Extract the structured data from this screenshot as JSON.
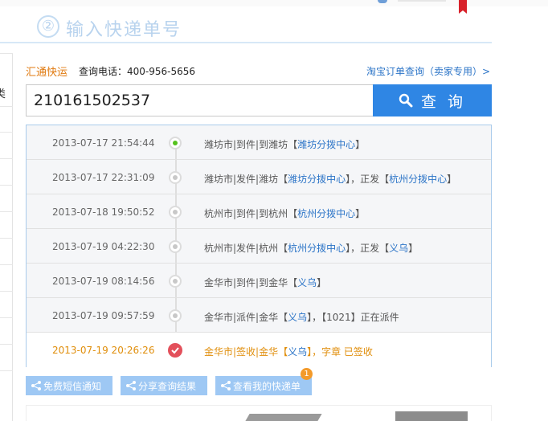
{
  "step": {
    "number": "②",
    "title": "输入快递单号"
  },
  "company": {
    "name": "汇通快运",
    "phone": "查询电话：400-956-5656"
  },
  "taobao_link": "淘宝订单查询（卖家专用）>",
  "search": {
    "value": "210161502537",
    "button_label": "查 询"
  },
  "left_rail": {
    "char": "类"
  },
  "timeline": [
    {
      "time": "2013-07-17 21:54:44",
      "text": "潍坊市|到件|到潍坊【",
      "link1": "潍坊分拨中心",
      "text2": "】",
      "link2": "",
      "text3": ""
    },
    {
      "time": "2013-07-17 22:31:09",
      "text": "潍坊市|发件|潍坊【",
      "link1": "潍坊分拨中心",
      "text2": "】，正发【",
      "link2": "杭州分拨中心",
      "text3": "】"
    },
    {
      "time": "2013-07-18 19:50:52",
      "text": "杭州市|到件|到杭州【",
      "link1": "杭州分拨中心",
      "text2": "】",
      "link2": "",
      "text3": ""
    },
    {
      "time": "2013-07-19 04:22:30",
      "text": "杭州市|发件|杭州【",
      "link1": "杭州分拨中心",
      "text2": "】，正发【",
      "link2": "义乌",
      "text3": "】"
    },
    {
      "time": "2013-07-19 08:14:56",
      "text": "金华市|到件|到金华【",
      "link1": "义乌",
      "text2": "】",
      "link2": "",
      "text3": ""
    },
    {
      "time": "2013-07-19 09:57:59",
      "text": "金华市|派件|金华【",
      "link1": "义乌",
      "text2": "】，【1021】正在派件",
      "link2": "",
      "text3": ""
    },
    {
      "time": "2013-07-19 20:26:26",
      "text": "金华市|签收|金华【",
      "link1": "义乌",
      "text2": "】，字章 已签收",
      "link2": "",
      "text3": ""
    }
  ],
  "actions": {
    "sms": "免费短信通知",
    "share": "分享查询结果",
    "mine": "查看我的快递单",
    "badge": "1"
  },
  "colors": {
    "accent": "#2f86e4",
    "company": "#e07a10",
    "delivered": "#e08e0b",
    "link": "#2b74c7"
  }
}
